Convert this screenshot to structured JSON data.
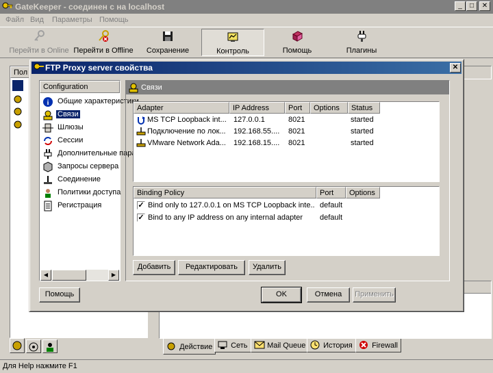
{
  "app": {
    "title": "GateKeeper - соединен с на localhost",
    "window_controls": [
      "minimize-icon",
      "maximize-icon",
      "close-icon"
    ]
  },
  "menu": [
    "Файл",
    "Вид",
    "Параметры",
    "Помощь"
  ],
  "toolbar": {
    "buttons": [
      {
        "label": "Перейти в Online",
        "icon": "key-icon",
        "enabled": false
      },
      {
        "label": "Перейти в Offline",
        "icon": "key-cancel-icon",
        "enabled": true
      },
      {
        "label": "Сохранение",
        "icon": "floppy-disk-icon",
        "enabled": true
      },
      {
        "label": "Контроль",
        "icon": "monitor-chart-icon",
        "enabled": true,
        "pressed": true
      },
      {
        "label": "Помощь",
        "icon": "help-book-icon",
        "enabled": true
      },
      {
        "label": "Плагины",
        "icon": "plug-icon",
        "enabled": true
      }
    ]
  },
  "background": {
    "left_panel_header": "Пол",
    "left_tabs": [
      "gatekeeper-tab-icon",
      "gears-tab-icon",
      "users-tab-icon"
    ],
    "bottom_tabs": [
      {
        "label": "Действие",
        "icon": "gears-icon"
      },
      {
        "label": "Сеть",
        "icon": "network-icon"
      },
      {
        "label": "Mail Queue",
        "icon": "envelope-icon"
      },
      {
        "label": "История",
        "icon": "clock-icon"
      },
      {
        "label": "Firewall",
        "icon": "stop-icon"
      }
    ]
  },
  "dialog": {
    "title": "FTP Proxy server свойства",
    "tree_header": "Configuration",
    "tree_items": [
      {
        "label": "Общие характеристики",
        "icon": "info-icon"
      },
      {
        "label": "Связи",
        "icon": "connections-icon",
        "selected": true
      },
      {
        "label": "Шлюзы",
        "icon": "gateway-icon"
      },
      {
        "label": "Сессии",
        "icon": "sessions-icon"
      },
      {
        "label": "Дополнительные параметры",
        "icon": "extra-params-icon"
      },
      {
        "label": "Запросы сервера",
        "icon": "server-requests-icon"
      },
      {
        "label": "Соединение",
        "icon": "connection-icon"
      },
      {
        "label": "Политики доступа",
        "icon": "access-policy-icon"
      },
      {
        "label": "Регистрация",
        "icon": "registration-icon"
      }
    ],
    "section_title": "Связи",
    "adapters": {
      "columns": [
        "Adapter",
        "IP Address",
        "Port",
        "Options",
        "Status"
      ],
      "rows": [
        {
          "adapter": "MS TCP Loopback int...",
          "ip": "127.0.0.1",
          "port": "8021",
          "options": "",
          "status": "started",
          "icon": "loopback-icon"
        },
        {
          "adapter": "Подключение по лок...",
          "ip": "192.168.55....",
          "port": "8021",
          "options": "",
          "status": "started",
          "icon": "lan-icon"
        },
        {
          "adapter": "VMware Network Ada...",
          "ip": "192.168.15....",
          "port": "8021",
          "options": "",
          "status": "started",
          "icon": "lan-icon"
        }
      ]
    },
    "bindings": {
      "columns": [
        "Binding Policy",
        "Port",
        "Options"
      ],
      "rows": [
        {
          "policy": "Bind only to 127.0.0.1 on MS TCP Loopback inte...",
          "port": "default",
          "options": "",
          "checked": true
        },
        {
          "policy": "Bind to any IP address on any internal adapter",
          "port": "default",
          "options": "",
          "checked": true
        }
      ]
    },
    "buttons": {
      "add": "Добавить",
      "edit": "Редактировать",
      "delete": "Удалить",
      "help": "Помощь",
      "ok": "OK",
      "cancel": "Отмена",
      "apply": "Применить"
    }
  },
  "status_bar": "Для Help нажмите F1"
}
